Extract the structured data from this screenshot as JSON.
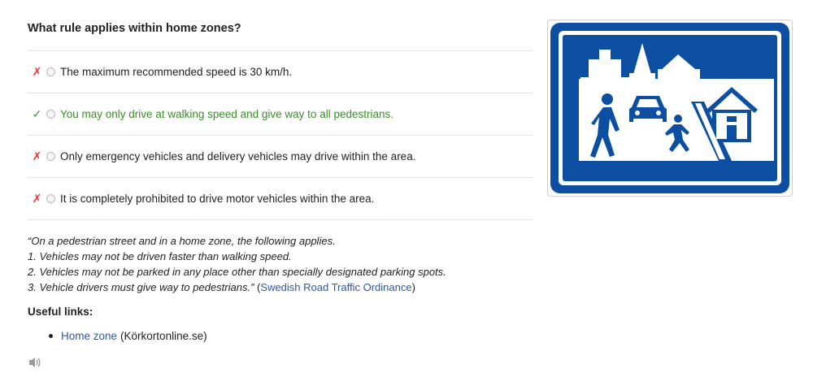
{
  "question": "What rule applies within home zones?",
  "options": [
    {
      "text": "The maximum recommended speed is 30 km/h.",
      "mark": "✗",
      "status": "wrong"
    },
    {
      "text": "You may only drive at walking speed and give way to all pedestrians.",
      "mark": "✓",
      "status": "correct"
    },
    {
      "text": "Only emergency vehicles and delivery vehicles may drive within the area.",
      "mark": "✗",
      "status": "wrong"
    },
    {
      "text": "It is completely prohibited to drive motor vehicles within the area.",
      "mark": "✗",
      "status": "wrong"
    }
  ],
  "explanation": {
    "line1": "“On a pedestrian street and in a home zone, the following applies.",
    "line2": "1. Vehicles may not be driven faster than walking speed.",
    "line3": "2. Vehicles may not be parked in any place other than specially designated parking spots.",
    "line4": "3. Vehicle drivers must give way to pedestrians.”",
    "source_prefix": "(",
    "source_link": "Swedish Road Traffic Ordinance",
    "source_suffix": ")"
  },
  "useful_links": {
    "title": "Useful links:",
    "items": [
      {
        "link": "Home zone",
        "source": "(Körkortonline.se)"
      }
    ]
  },
  "colors": {
    "sign_blue": "#0b4ea2",
    "correct_green": "#3b8c2a",
    "wrong_red": "#e03b3b",
    "link_blue": "#2b59a5"
  },
  "icons": [
    "cross-icon",
    "check-icon",
    "radio-icon",
    "speaker-icon",
    "home-zone-sign"
  ]
}
